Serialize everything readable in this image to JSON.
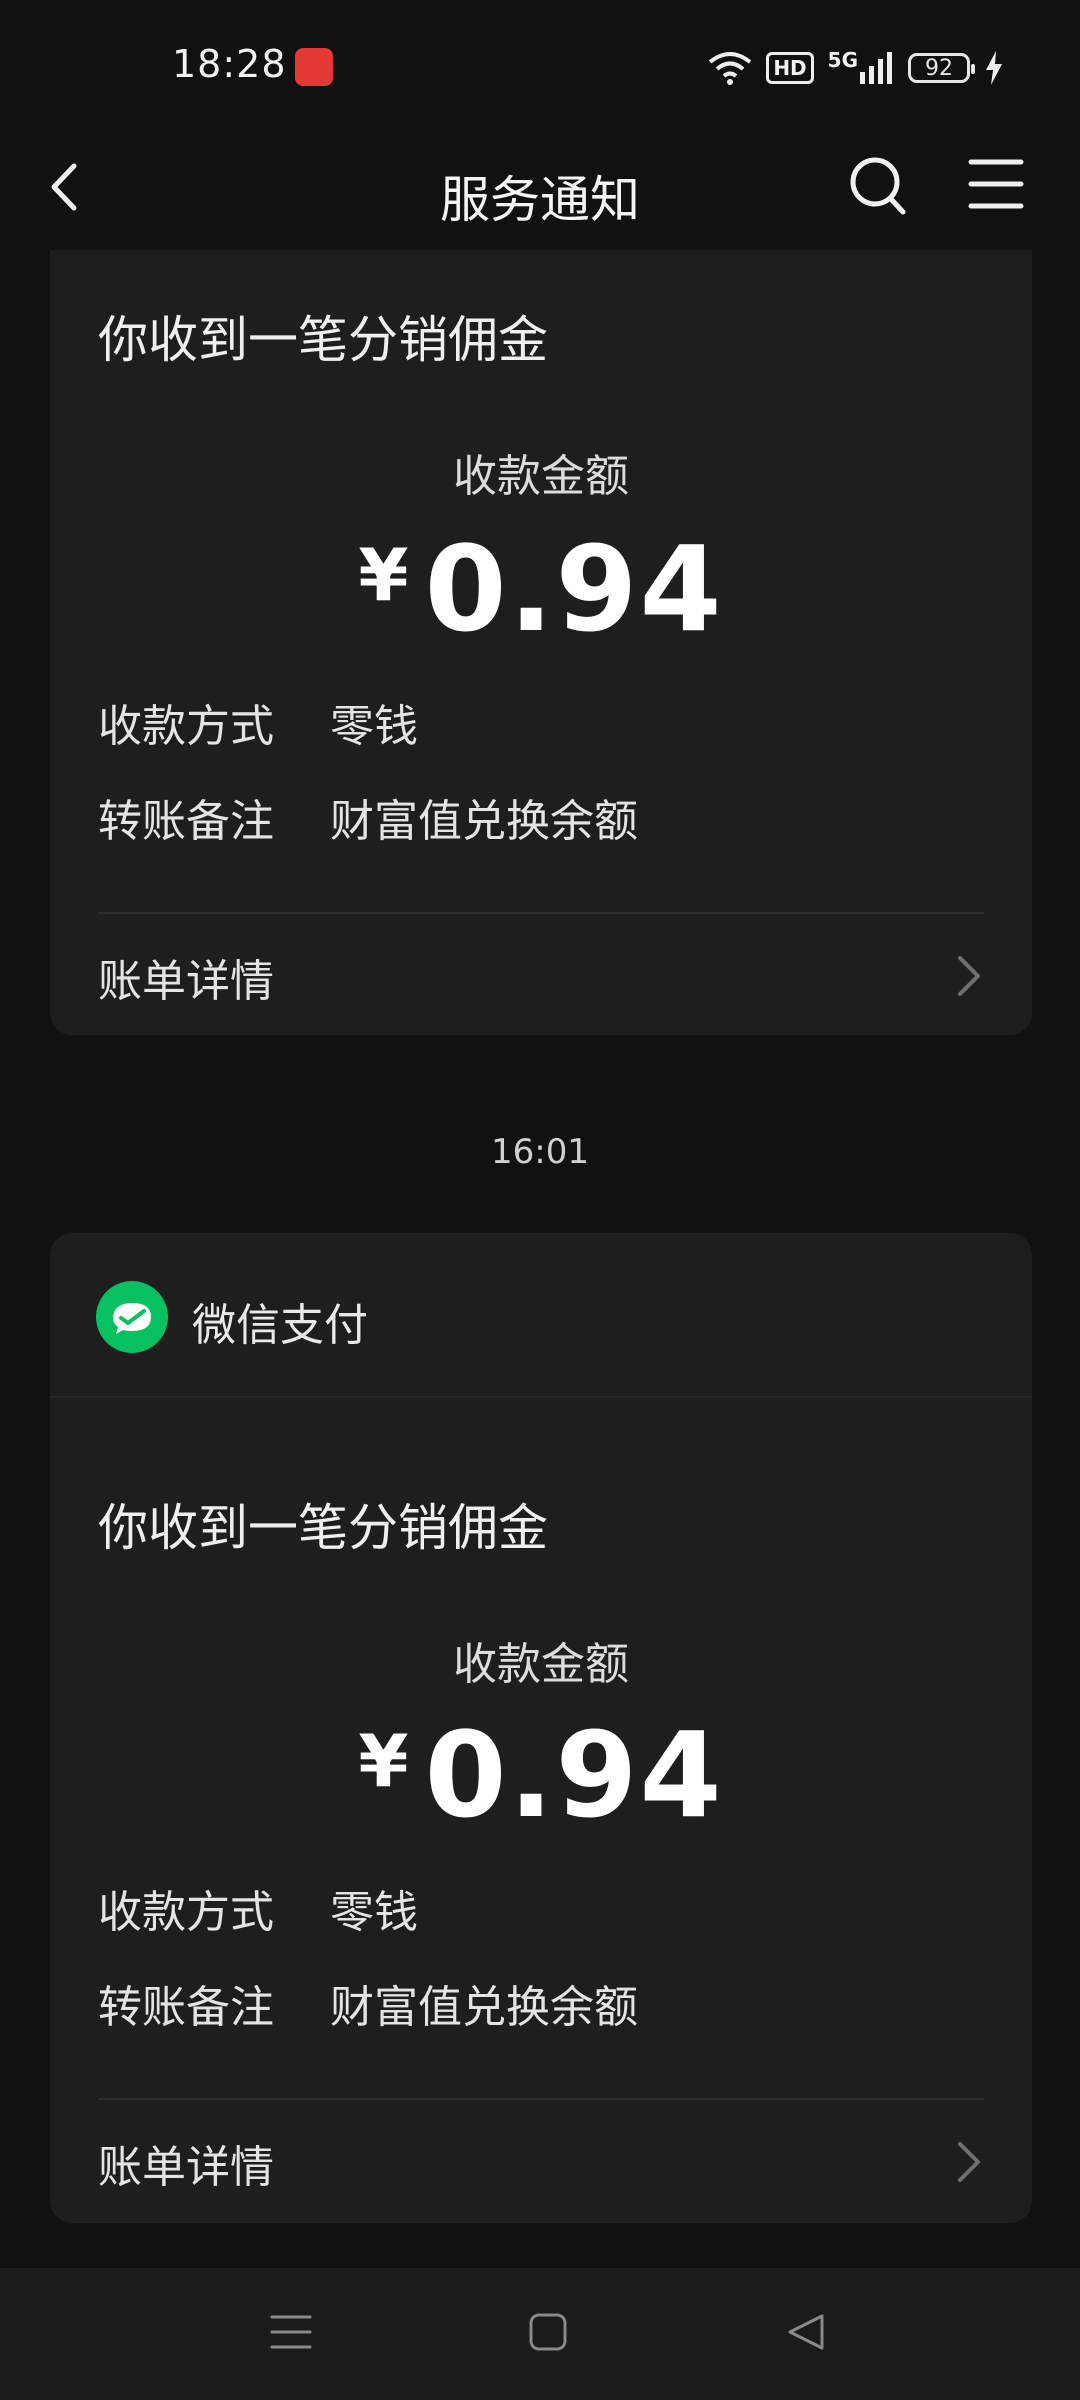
{
  "status_bar": {
    "time": "18:28",
    "network": "5G",
    "hd_label": "HD",
    "battery": "92"
  },
  "nav": {
    "title": "服务通知"
  },
  "notifications": [
    {
      "title": "你收到一笔分销佣金",
      "amount_label": "收款金额",
      "currency": "¥",
      "amount": "0.94",
      "payment_method_label": "收款方式",
      "payment_method": "零钱",
      "remark_label": "转账备注",
      "remark": "财富值兑换余额",
      "bill_link": "账单详情"
    },
    {
      "sender": "微信支付",
      "title": "你收到一笔分销佣金",
      "amount_label": "收款金额",
      "currency": "¥",
      "amount": "0.94",
      "payment_method_label": "收款方式",
      "payment_method": "零钱",
      "remark_label": "转账备注",
      "remark": "财富值兑换余额",
      "bill_link": "账单详情"
    }
  ],
  "time_separator": "16:01",
  "colors": {
    "background": "#111111",
    "card": "#1e1e1e",
    "wechat_green": "#07c160"
  }
}
